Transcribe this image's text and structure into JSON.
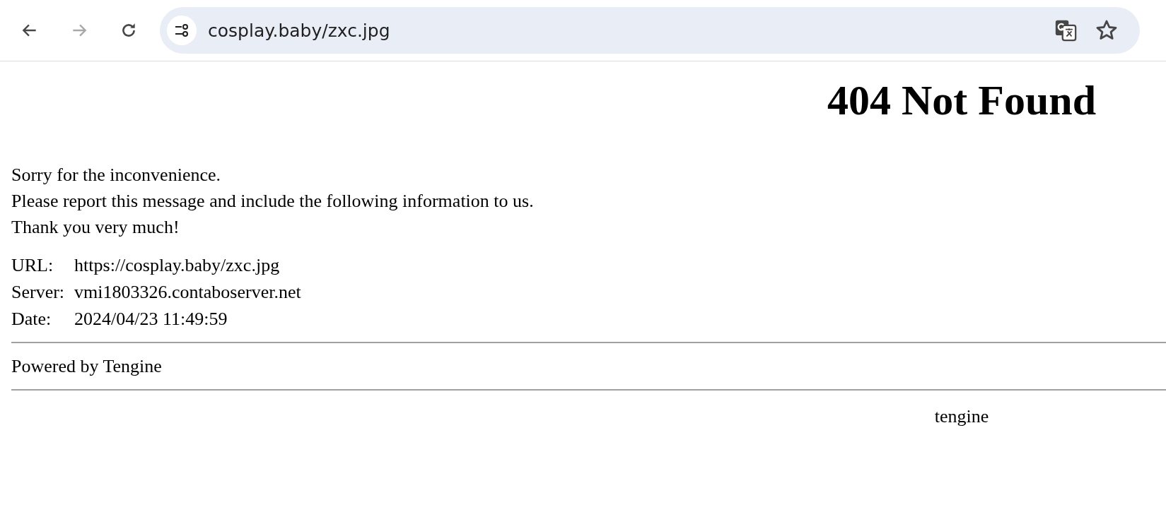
{
  "toolbar": {
    "buttons": [
      {
        "kind": "back",
        "disabled": false
      },
      {
        "kind": "forward",
        "disabled": true
      },
      {
        "kind": "reload",
        "disabled": false
      }
    ],
    "address": "cosplay.baby/zxc.jpg"
  },
  "page": {
    "heading": "404 Not Found",
    "message": [
      "Sorry for the inconvenience.",
      "Please report this message and include the following information to us.",
      "Thank you very much!"
    ],
    "info": [
      {
        "label": "URL:",
        "value": "https://cosplay.baby/zxc.jpg"
      },
      {
        "label": "Server:",
        "value": "vmi1803326.contaboserver.net"
      },
      {
        "label": "Date:",
        "value": "2024/04/23 11:49:59"
      }
    ],
    "powered_by": "Powered by Tengine",
    "footer": "tengine"
  }
}
